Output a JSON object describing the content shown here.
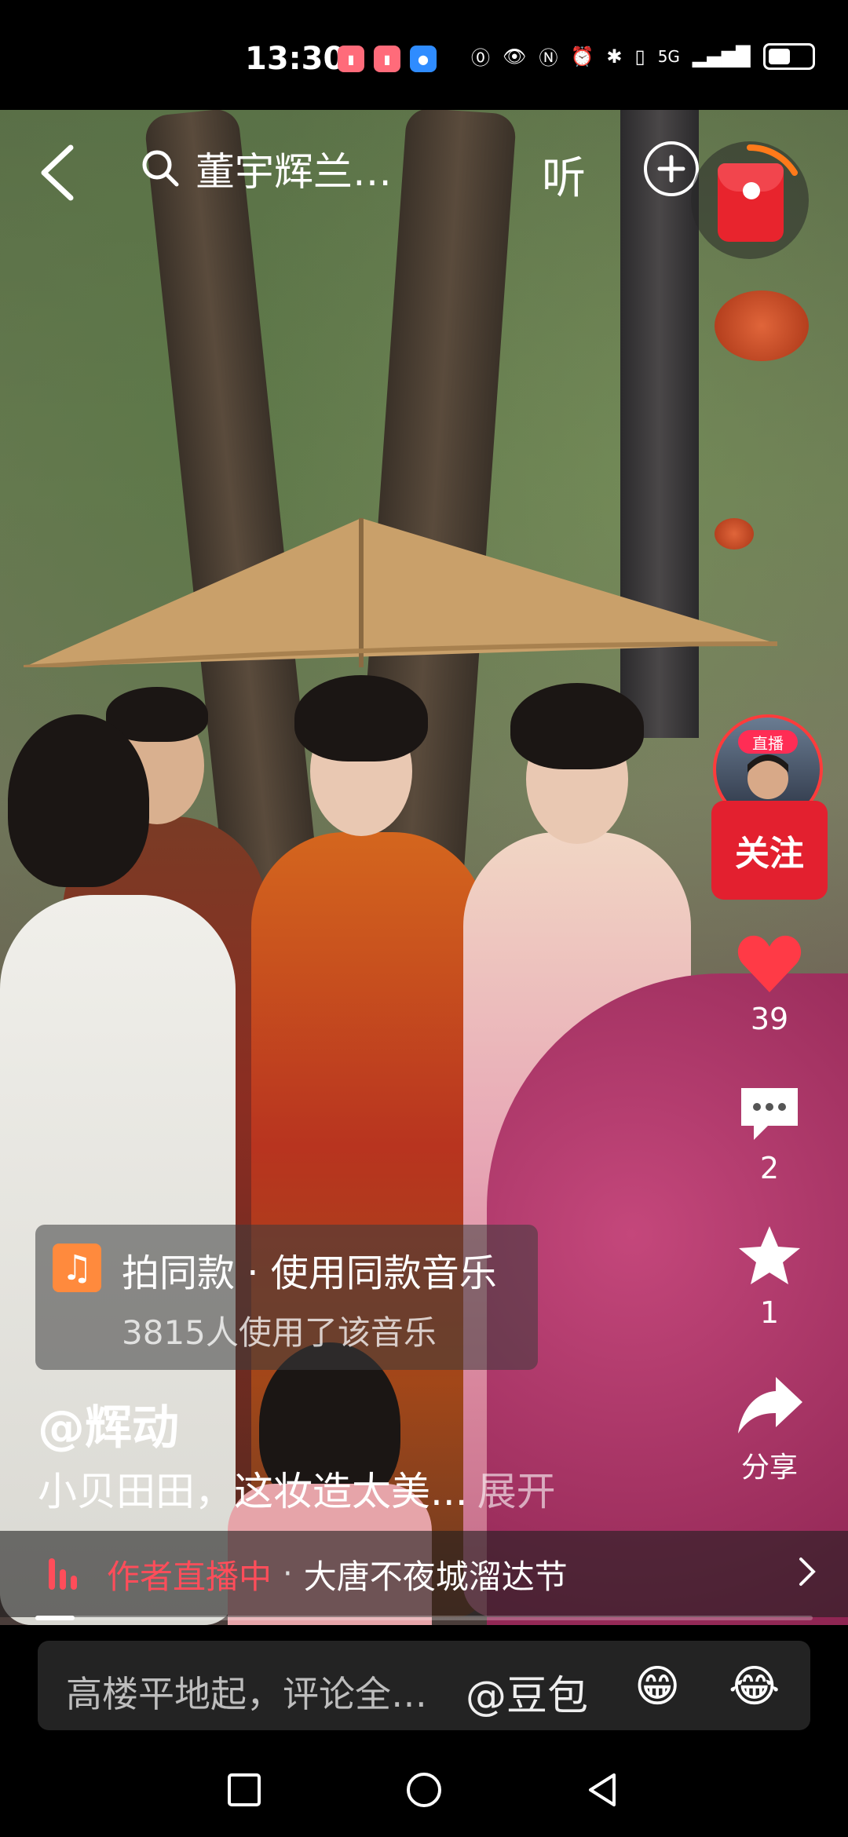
{
  "status_bar": {
    "time": "13:30",
    "network_label": "5G",
    "battery_level": 0.45
  },
  "top_bar": {
    "search_text": "董宇辉兰…",
    "listen_label": "听"
  },
  "right_rail": {
    "live_tag": "直播",
    "follow_label": "关注",
    "likes_count": "39",
    "comments_count": "2",
    "favorites_count": "1",
    "share_label": "分享"
  },
  "music_card": {
    "title": "拍同款 · 使用同款音乐",
    "subtitle": "3815人使用了该音乐"
  },
  "post": {
    "author": "@辉动",
    "caption": "小贝田田，这妆造太美...",
    "expand_label": "展开"
  },
  "live_bar": {
    "status": "作者直播中",
    "separator": "·",
    "title": "大唐不夜城溜达节"
  },
  "video_progress": 0.05,
  "comment_bar": {
    "placeholder": "高楼平地起，评论全…",
    "mention": "@豆包",
    "emoji_1": "😁",
    "emoji_2": "😂"
  },
  "colors": {
    "accent_red": "#e3202f",
    "live_pink": "#ff4d5a",
    "music_orange": "#ff8a3d"
  }
}
